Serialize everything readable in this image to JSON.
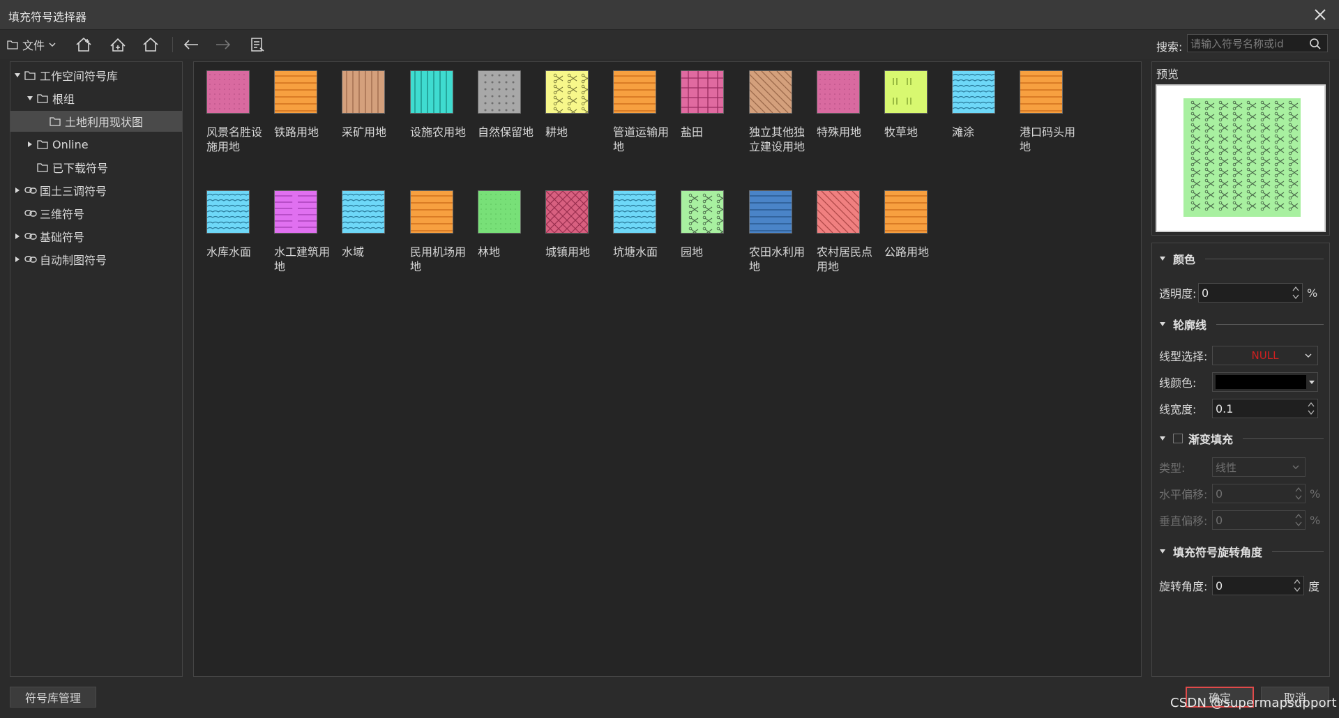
{
  "window": {
    "title": "填充符号选择器"
  },
  "toolbar": {
    "file_label": "文件",
    "search_label": "搜索:",
    "search_placeholder": "请输入符号名称或id"
  },
  "tree": [
    {
      "label": "工作空间符号库",
      "type": "folder",
      "expanded": true
    },
    {
      "label": "根组",
      "type": "folder",
      "expanded": true
    },
    {
      "label": "土地利用现状图",
      "type": "folder",
      "selected": true
    },
    {
      "label": "Online",
      "type": "folder",
      "expanded": false
    },
    {
      "label": "已下载符号",
      "type": "folder"
    },
    {
      "label": "国土三调符号",
      "type": "link",
      "expanded": false
    },
    {
      "label": "三维符号",
      "type": "link"
    },
    {
      "label": "基础符号",
      "type": "link",
      "expanded": false
    },
    {
      "label": "自动制图符号",
      "type": "link",
      "expanded": false
    }
  ],
  "symbols": [
    {
      "label": "风景名胜设施用地",
      "pattern": "dotted",
      "color": "#d96aa0",
      "fg": "#b04c80"
    },
    {
      "label": "铁路用地",
      "pattern": "hlines",
      "color": "#f7a040",
      "fg": "#d0701c"
    },
    {
      "label": "采矿用地",
      "pattern": "vlines",
      "color": "#d4a07c",
      "fg": "#9c6a4c"
    },
    {
      "label": "设施农用地",
      "pattern": "vlines",
      "color": "#3fdcd0",
      "fg": "#1a8a80"
    },
    {
      "label": "自然保留地",
      "pattern": "dots",
      "color": "#a8a8a8",
      "fg": "#6f6f6f"
    },
    {
      "label": "耕地",
      "pattern": "scissors",
      "color": "#f7f78a",
      "fg": "#7a7a3a"
    },
    {
      "label": "管道运输用地",
      "pattern": "hlines",
      "color": "#f7a040",
      "fg": "#d0701c"
    },
    {
      "label": "盐田",
      "pattern": "grid",
      "color": "#e06aa0",
      "fg": "#9a2c60"
    },
    {
      "label": "独立其他独立建设用地",
      "pattern": "diag",
      "color": "#d4a07c",
      "fg": "#9c6a4c"
    },
    {
      "label": "特殊用地",
      "pattern": "dotted",
      "color": "#d96aa0",
      "fg": "#b04c80"
    },
    {
      "label": "牧草地",
      "pattern": "grass",
      "color": "#d8f870",
      "fg": "#7a9a2a"
    },
    {
      "label": "滩涂",
      "pattern": "waves",
      "color": "#6ed8f8",
      "fg": "#2a7a9a"
    },
    {
      "label": "港口码头用地",
      "pattern": "hlines",
      "color": "#f7a040",
      "fg": "#d0701c"
    },
    {
      "label": "水库水面",
      "pattern": "waves",
      "color": "#6ed8f8",
      "fg": "#2a7a9a"
    },
    {
      "label": "水工建筑用地",
      "pattern": "dashes",
      "color": "#e070f0",
      "fg": "#a03ab0"
    },
    {
      "label": "水域",
      "pattern": "waves",
      "color": "#6ed8f8",
      "fg": "#2a7a9a"
    },
    {
      "label": "民用机场用地",
      "pattern": "hlines",
      "color": "#f7a040",
      "fg": "#d0701c"
    },
    {
      "label": "林地",
      "pattern": "dotted",
      "color": "#78e078",
      "fg": "#5cc05c"
    },
    {
      "label": "城镇用地",
      "pattern": "cross",
      "color": "#d86080",
      "fg": "#9a3050"
    },
    {
      "label": "坑塘水面",
      "pattern": "waves",
      "color": "#6ed8f8",
      "fg": "#2a7a9a"
    },
    {
      "label": "园地",
      "pattern": "scissors",
      "color": "#a8f0a0",
      "fg": "#4a6a4a"
    },
    {
      "label": "农田水利用地",
      "pattern": "hlines",
      "color": "#4a84c8",
      "fg": "#2a5a90"
    },
    {
      "label": "农村居民点用地",
      "pattern": "diag",
      "color": "#f08080",
      "fg": "#b04a4a"
    },
    {
      "label": "公路用地",
      "pattern": "hlines",
      "color": "#f7a040",
      "fg": "#d0701c"
    }
  ],
  "preview": {
    "label": "预览",
    "fill_color": "#a8f0a0",
    "icon": "scissors-pattern"
  },
  "properties": {
    "color_section": "颜色",
    "transparency_label": "透明度:",
    "transparency_value": "0",
    "transparency_unit": "%",
    "outline_section": "轮廓线",
    "line_type_label": "线型选择:",
    "line_type_value": "NULL",
    "line_color_label": "线颜色:",
    "line_color_value": "#000000",
    "line_width_label": "线宽度:",
    "line_width_value": "0.1",
    "gradient_section": "渐变填充",
    "gradient_enabled": false,
    "type_label": "类型:",
    "type_value": "线性",
    "h_offset_label": "水平偏移:",
    "h_offset_value": "0",
    "h_offset_unit": "%",
    "v_offset_label": "垂直偏移:",
    "v_offset_value": "0",
    "v_offset_unit": "%",
    "rotation_section": "填充符号旋转角度",
    "rotation_label": "旋转角度:",
    "rotation_value": "0",
    "rotation_unit": "度"
  },
  "footer": {
    "manage_label": "符号库管理",
    "ok_label": "确定",
    "cancel_label": "取消",
    "watermark": "CSDN @supermapsupport"
  }
}
